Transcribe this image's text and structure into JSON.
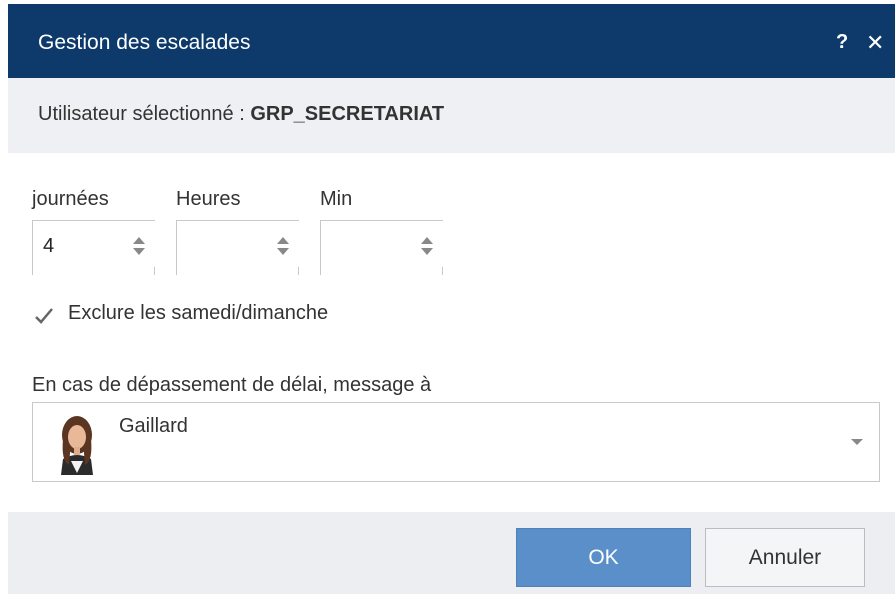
{
  "dialog": {
    "title": "Gestion des escalades",
    "help_label": "?",
    "close_label": "✕"
  },
  "user": {
    "label": "Utilisateur sélectionné : ",
    "value": "GRP_SECRETARIAT"
  },
  "duration": {
    "days_label": "journées",
    "days_value": "4",
    "hours_label": "Heures",
    "hours_value": "",
    "minutes_label": "Min",
    "minutes_value": ""
  },
  "exclude_weekend": {
    "label": "Exclure les samedi/dimanche",
    "checked": true
  },
  "recipient": {
    "label": "En cas de dépassement de délai, message à",
    "selected": "Gaillard"
  },
  "buttons": {
    "ok": "OK",
    "cancel": "Annuler"
  },
  "colors": {
    "titlebar": "#0d3a6a",
    "ok_button": "#5b8fc9"
  }
}
